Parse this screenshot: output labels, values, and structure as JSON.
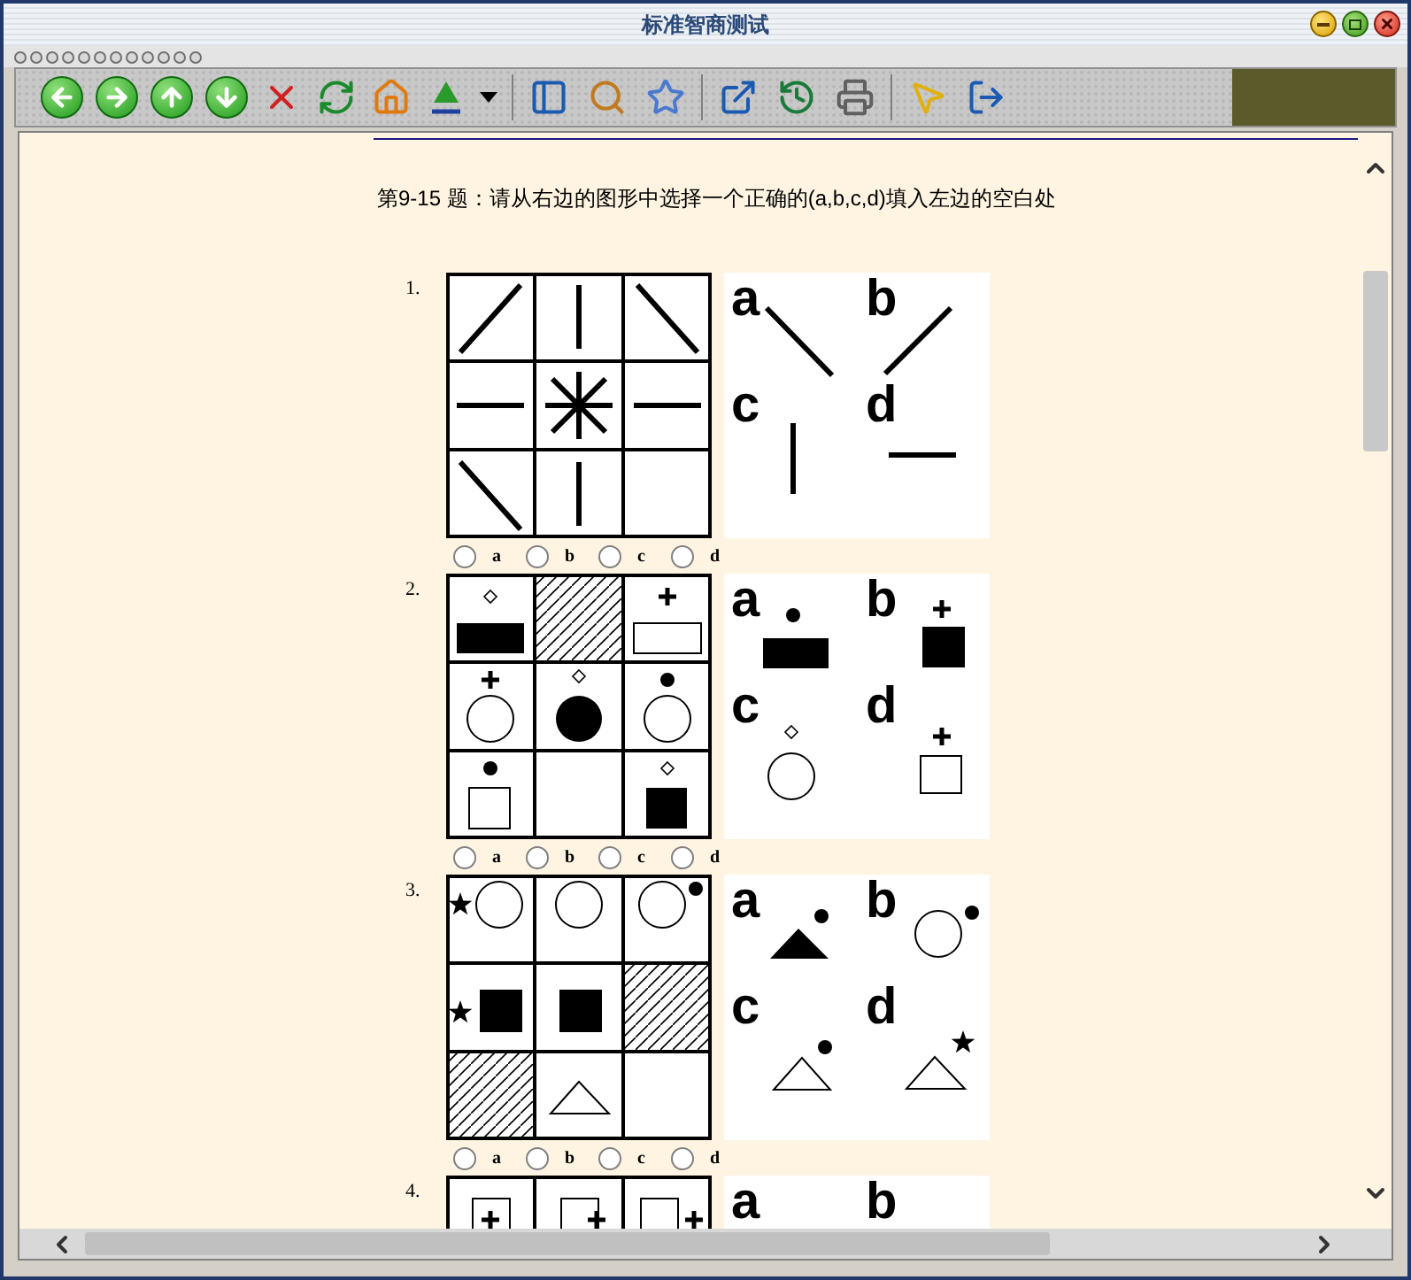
{
  "window": {
    "title": "标准智商测试"
  },
  "instruction": "第9-15 题：请从右边的图形中选择一个正确的(a,b,c,d)填入左边的空白处",
  "questions": [
    {
      "number": "1.",
      "options": [
        "a",
        "b",
        "c",
        "d"
      ],
      "choices": [
        {
          "label": "a",
          "selected": false
        },
        {
          "label": "b",
          "selected": false
        },
        {
          "label": "c",
          "selected": false
        },
        {
          "label": "d",
          "selected": false
        }
      ]
    },
    {
      "number": "2.",
      "options": [
        "a",
        "b",
        "c",
        "d"
      ],
      "choices": [
        {
          "label": "a",
          "selected": false
        },
        {
          "label": "b",
          "selected": false
        },
        {
          "label": "c",
          "selected": false
        },
        {
          "label": "d",
          "selected": false
        }
      ]
    },
    {
      "number": "3.",
      "options": [
        "a",
        "b",
        "c",
        "d"
      ],
      "choices": [
        {
          "label": "a",
          "selected": false
        },
        {
          "label": "b",
          "selected": false
        },
        {
          "label": "c",
          "selected": false
        },
        {
          "label": "d",
          "selected": false
        }
      ]
    },
    {
      "number": "4.",
      "options": [
        "a",
        "b"
      ]
    }
  ]
}
